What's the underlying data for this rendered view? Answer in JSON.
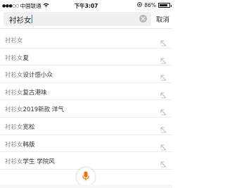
{
  "status_bar": {
    "carrier": "中国联通",
    "time": "下午3:07",
    "battery_percent": "86%",
    "battery_level": 0.86
  },
  "search": {
    "query": "衬衫女",
    "cancel_label": "取消"
  },
  "suggestions": [
    {
      "prefix": "衬衫女",
      "rest": ""
    },
    {
      "prefix": "衬衫女",
      "rest": "夏"
    },
    {
      "prefix": "衬衫女",
      "rest": "设计感小众"
    },
    {
      "prefix": "衬衫女",
      "rest": "复古港味"
    },
    {
      "prefix": "衬衫女",
      "rest": "2019新款 洋气"
    },
    {
      "prefix": "衬衫女",
      "rest": "宽松"
    },
    {
      "prefix": "衬衫女",
      "rest": "韩版"
    },
    {
      "prefix": "衬衫女",
      "rest": "学生 学院风"
    }
  ],
  "colors": {
    "accent": "#ff6a00",
    "caret": "#2a7ae2"
  },
  "icons": {
    "fill_arrow": "arrow-up-left-icon",
    "voice": "microphone-icon",
    "clear": "clear-icon"
  }
}
